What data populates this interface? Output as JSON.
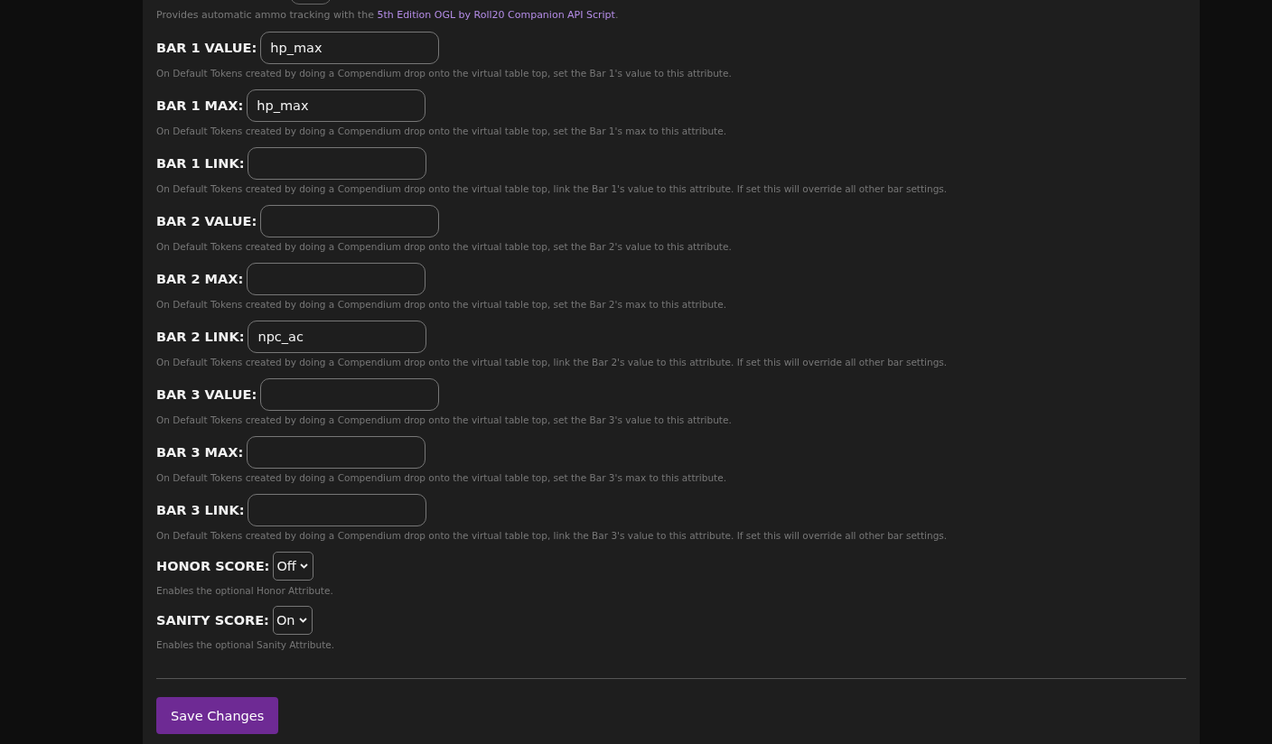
{
  "ammo_note": {
    "text_before": "Provides automatic ammo tracking with the ",
    "link": "5th Edition OGL by Roll20 Companion API Script",
    "text_after": "."
  },
  "settings": [
    {
      "kind": "text",
      "label": "BAR 1 VALUE:",
      "value": "hp_max",
      "description": "On Default Tokens created by doing a Compendium drop onto the virtual table top, set the Bar 1's value to this attribute."
    },
    {
      "kind": "text",
      "label": "BAR 1 MAX:",
      "value": "hp_max",
      "description": "On Default Tokens created by doing a Compendium drop onto the virtual table top, set the Bar 1's max to this attribute."
    },
    {
      "kind": "text",
      "label": "BAR 1 LINK:",
      "description": "On Default Tokens created by doing a Compendium drop onto the virtual table top, link the Bar 1's value to this attribute. If set this will override all other bar settings."
    },
    {
      "kind": "text",
      "label": "BAR 2 VALUE:",
      "description": "On Default Tokens created by doing a Compendium drop onto the virtual table top, set the Bar 2's value to this attribute."
    },
    {
      "kind": "text",
      "label": "BAR 2 MAX:",
      "description": "On Default Tokens created by doing a Compendium drop onto the virtual table top, set the Bar 2's max to this attribute."
    },
    {
      "kind": "text",
      "label": "BAR 2 LINK:",
      "value": "npc_ac",
      "description": "On Default Tokens created by doing a Compendium drop onto the virtual table top, link the Bar 2's value to this attribute. If set this will override all other bar settings."
    },
    {
      "kind": "text",
      "label": "BAR 3 VALUE:",
      "description": "On Default Tokens created by doing a Compendium drop onto the virtual table top, set the Bar 3's value to this attribute."
    },
    {
      "kind": "text",
      "label": "BAR 3 MAX:",
      "description": "On Default Tokens created by doing a Compendium drop onto the virtual table top, set the Bar 3's max to this attribute."
    },
    {
      "kind": "text",
      "label": "BAR 3 LINK:",
      "description": "On Default Tokens created by doing a Compendium drop onto the virtual table top, link the Bar 3's value to this attribute. If set this will override all other bar settings."
    },
    {
      "kind": "select",
      "label": "HONOR SCORE:",
      "value": "Off",
      "description": "Enables the optional Honor Attribute."
    },
    {
      "kind": "select",
      "label": "SANITY SCORE:",
      "value": "On",
      "description": "Enables the optional Sanity Attribute."
    }
  ],
  "save_button": "Save Changes"
}
